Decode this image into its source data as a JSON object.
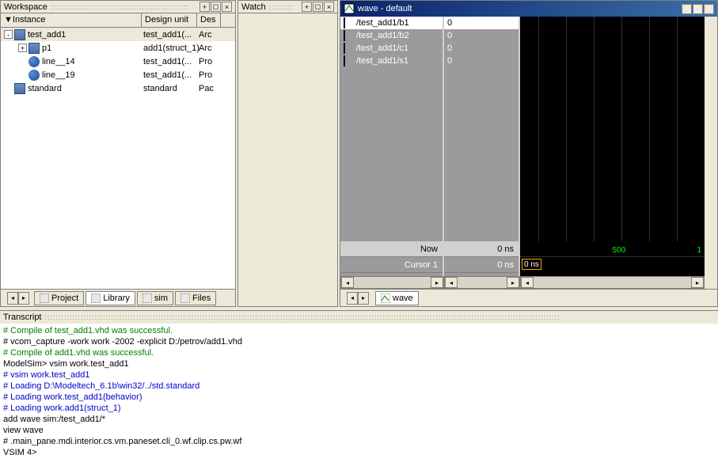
{
  "workspace": {
    "title": "Workspace",
    "columns": {
      "c1": "Instance",
      "c2": "Design unit",
      "c3": "Des"
    },
    "rows": [
      {
        "expander": "-",
        "indent": 0,
        "icon": "entity",
        "name": "test_add1",
        "unit": "test_add1(...",
        "desc": "Arc",
        "selected": true
      },
      {
        "expander": "+",
        "indent": 1,
        "icon": "block",
        "name": "p1",
        "unit": "add1(struct_1)",
        "desc": "Arc"
      },
      {
        "expander": "",
        "indent": 1,
        "icon": "process",
        "name": "line__14",
        "unit": "test_add1(...",
        "desc": "Pro"
      },
      {
        "expander": "",
        "indent": 1,
        "icon": "process",
        "name": "line__19",
        "unit": "test_add1(...",
        "desc": "Pro"
      },
      {
        "expander": "",
        "indent": 0,
        "icon": "block",
        "name": "standard",
        "unit": "standard",
        "desc": "Pac"
      }
    ],
    "tabs": [
      {
        "label": "Project",
        "icon": "project-icon"
      },
      {
        "label": "Library",
        "icon": "library-icon",
        "active": true
      },
      {
        "label": "sim",
        "icon": "sim-icon"
      },
      {
        "label": "Files",
        "icon": "files-icon"
      }
    ]
  },
  "watch": {
    "title": "Watch"
  },
  "wave": {
    "title": "wave - default",
    "signals": [
      {
        "name": "/test_add1/b1",
        "val": "0",
        "selected": true
      },
      {
        "name": "/test_add1/b2",
        "val": "0"
      },
      {
        "name": "/test_add1/c1",
        "val": "0"
      },
      {
        "name": "/test_add1/s1",
        "val": "0"
      }
    ],
    "now_label": "Now",
    "now_val": "0 ns",
    "cursor_label": "Cursor 1",
    "cursor_val": "0 ns",
    "cursor_pos": "0 ns",
    "tick_500": "500",
    "tick_1": "1",
    "tab": "wave"
  },
  "transcript": {
    "title": "Transcript",
    "lines": [
      {
        "cls": "t-green",
        "text": "# Compile of test_add1.vhd was successful."
      },
      {
        "cls": "t-black",
        "text": "# vcom_capture -work work -2002 -explicit D:/petrov/add1.vhd"
      },
      {
        "cls": "t-green",
        "text": "# Compile of add1.vhd was successful."
      },
      {
        "cls": "t-black",
        "text": "ModelSim>  vsim work.test_add1"
      },
      {
        "cls": "t-blue",
        "text": "# vsim work.test_add1"
      },
      {
        "cls": "t-blue",
        "text": "# Loading D:\\Modeltech_6.1b\\win32/../std.standard"
      },
      {
        "cls": "t-blue",
        "text": "# Loading work.test_add1(behavior)"
      },
      {
        "cls": "t-blue",
        "text": "# Loading work.add1(struct_1)"
      },
      {
        "cls": "t-black",
        "text": "add wave sim:/test_add1/*"
      },
      {
        "cls": "t-black",
        "text": "view wave"
      },
      {
        "cls": "t-black",
        "text": "# .main_pane.mdi.interior.cs.vm.paneset.cli_0.wf.clip.cs.pw.wf"
      },
      {
        "cls": "t-black",
        "text": " "
      },
      {
        "cls": "t-black",
        "text": "VSIM 4>"
      }
    ]
  }
}
